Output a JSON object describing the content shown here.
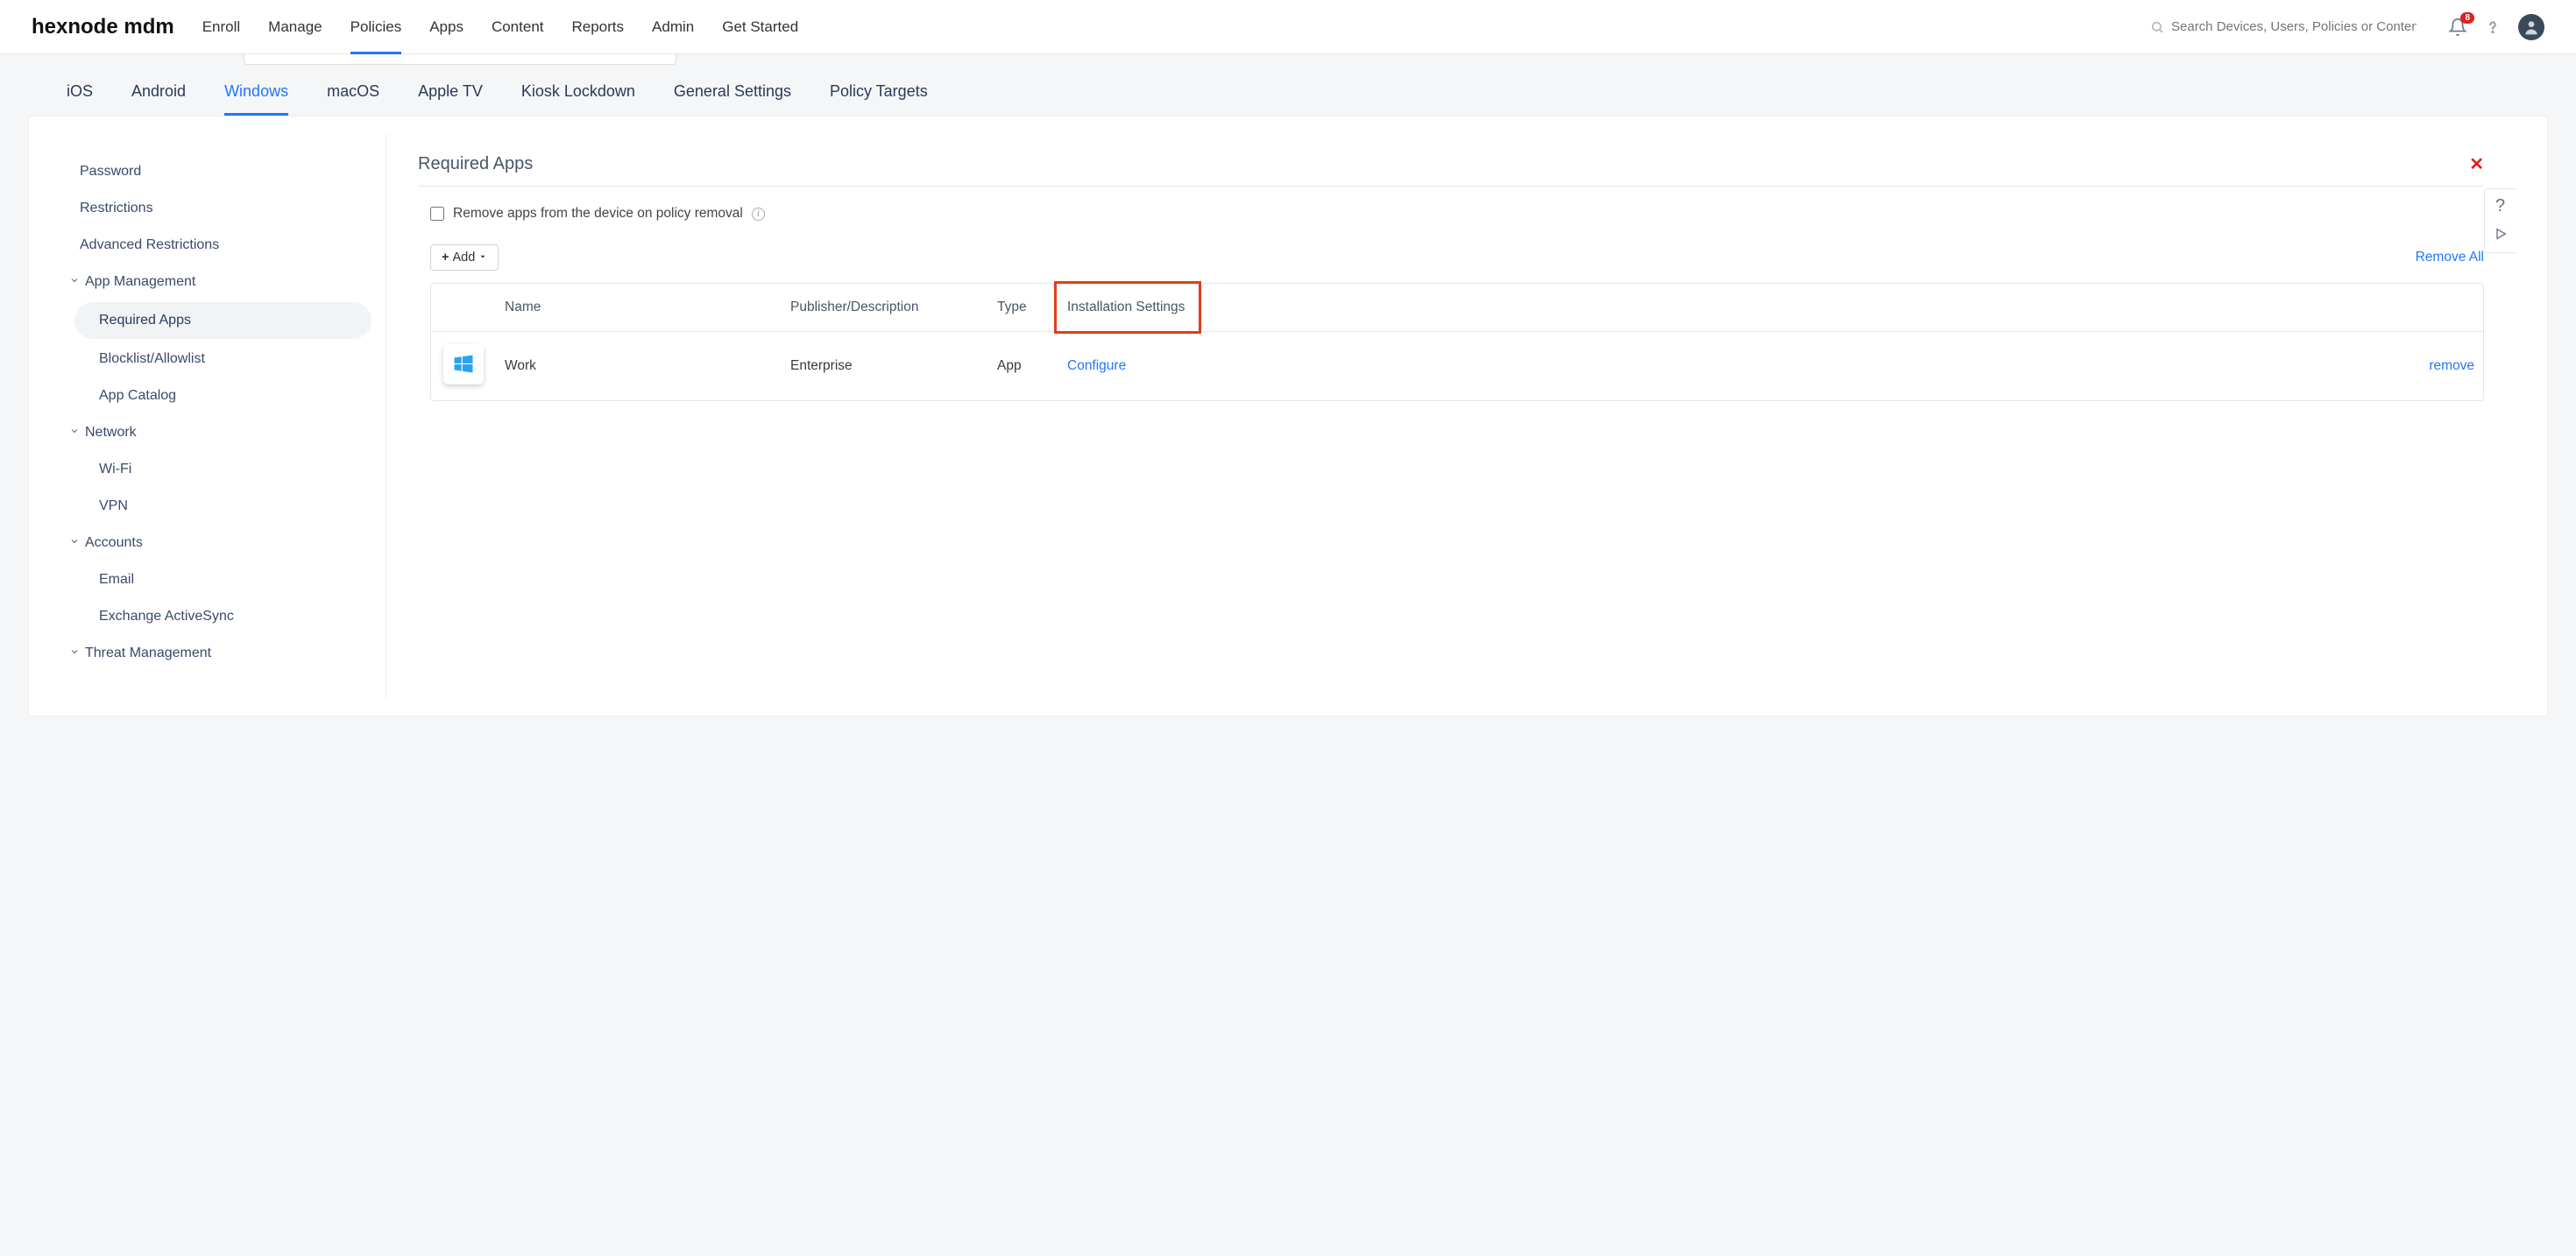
{
  "brand": "hexnode mdm",
  "topnav": {
    "items": [
      "Enroll",
      "Manage",
      "Policies",
      "Apps",
      "Content",
      "Reports",
      "Admin",
      "Get Started"
    ],
    "active_index": 2
  },
  "search": {
    "placeholder": "Search Devices, Users, Policies or Content"
  },
  "notifications": {
    "count": "8"
  },
  "subtabs": {
    "items": [
      "iOS",
      "Android",
      "Windows",
      "macOS",
      "Apple TV",
      "Kiosk Lockdown",
      "General Settings",
      "Policy Targets"
    ],
    "active_index": 2
  },
  "sidebar": {
    "plain": [
      "Password",
      "Restrictions",
      "Advanced Restrictions"
    ],
    "groups": [
      {
        "label": "App Management",
        "items": [
          "Required Apps",
          "Blocklist/Allowlist",
          "App Catalog"
        ],
        "active_item_index": 0
      },
      {
        "label": "Network",
        "items": [
          "Wi-Fi",
          "VPN"
        ]
      },
      {
        "label": "Accounts",
        "items": [
          "Email",
          "Exchange ActiveSync"
        ]
      },
      {
        "label": "Threat Management",
        "items": []
      }
    ]
  },
  "content": {
    "title": "Required Apps",
    "option_label": "Remove apps from the device on policy removal",
    "add_label": "Add",
    "remove_all_label": "Remove All",
    "columns": {
      "name": "Name",
      "publisher": "Publisher/Description",
      "type": "Type",
      "install": "Installation Settings"
    },
    "rows": [
      {
        "name": "Work",
        "publisher": "Enterprise",
        "type": "App",
        "configure": "Configure",
        "remove": "remove"
      }
    ]
  }
}
